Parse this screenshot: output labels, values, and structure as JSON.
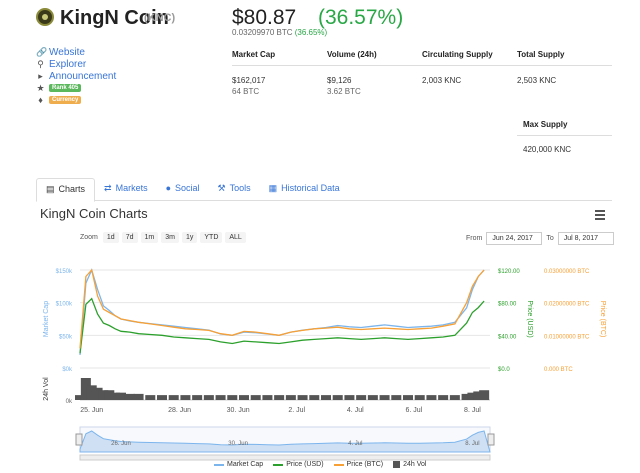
{
  "header": {
    "name": "KingN Coin",
    "symbol": "(KNC)",
    "price_usd": "$80.87",
    "change_usd": "(36.57%)",
    "price_btc": "0.03209970 BTC",
    "change_btc": "(36.65%)"
  },
  "links": {
    "website": "Website",
    "explorer": "Explorer",
    "announcement": "Announcement",
    "rank": "Rank 405",
    "category": "Currency"
  },
  "stats": {
    "headers": [
      "Market Cap",
      "Volume (24h)",
      "Circulating Supply",
      "Total Supply"
    ],
    "market_cap": "$162,017",
    "market_cap_btc": "64 BTC",
    "volume": "$9,126",
    "volume_btc": "3.62 BTC",
    "circulating": "2,003 KNC",
    "total": "2,503 KNC",
    "max_supply_label": "Max Supply",
    "max_supply": "420,000 KNC"
  },
  "tabs": [
    "Charts",
    "Markets",
    "Social",
    "Tools",
    "Historical Data"
  ],
  "charts_title": "KingN Coin Charts",
  "zoom": {
    "label": "Zoom",
    "buttons": [
      "1d",
      "7d",
      "1m",
      "3m",
      "1y",
      "YTD",
      "ALL"
    ],
    "from_label": "From",
    "from": "Jun 24, 2017",
    "to_label": "To",
    "to": "Jul 8, 2017"
  },
  "colors": {
    "market_cap": "#7cb5ec",
    "price_usd": "#2ca02c",
    "price_btc": "#f7a035",
    "volume": "#555555"
  },
  "chart_data": {
    "type": "line",
    "x_ticks": [
      "25. Jun",
      "28. Jun",
      "30. Jun",
      "2. Jul",
      "4. Jul",
      "6. Jul",
      "8. Jul"
    ],
    "navigator_ticks": [
      "26. Jun",
      "30. Jun",
      "4. Jul",
      "8. Jul"
    ],
    "left_axis": {
      "label": "Market Cap",
      "ticks": [
        "$0k",
        "$50k",
        "$100k",
        "$150k"
      ],
      "ylim": [
        0,
        150000
      ]
    },
    "usd_axis": {
      "label": "Price (USD)",
      "ticks": [
        "$0.0",
        "$40.00",
        "$80.00",
        "$120.00"
      ],
      "ylim": [
        0,
        120
      ]
    },
    "btc_axis": {
      "label": "Price (BTC)",
      "ticks": [
        "0.000 BTC",
        "0.01000000 BTC",
        "0.02000000 BTC",
        "0.03000000 BTC"
      ],
      "ylim": [
        0,
        0.03
      ]
    },
    "volume_axis": {
      "label": "24h Vol",
      "ticks": [
        "0k"
      ]
    },
    "x": [
      24.6,
      24.8,
      25.0,
      25.2,
      25.4,
      25.6,
      25.8,
      26.0,
      26.3,
      26.6,
      27.0,
      27.4,
      27.8,
      28.2,
      28.6,
      29.0,
      29.4,
      29.8,
      30.2,
      30.6,
      31.0,
      31.4,
      31.8,
      32.2,
      32.6,
      33.0,
      33.4,
      33.8,
      34.2,
      34.6,
      35.0,
      35.4,
      35.8,
      36.2,
      36.6,
      37.0,
      37.4,
      37.8,
      38.0,
      38.2,
      38.4
    ],
    "series": [
      {
        "name": "Market Cap",
        "axis": "left",
        "values": [
          20000,
          130000,
          150000,
          120000,
          95000,
          88000,
          80000,
          75000,
          72000,
          70000,
          68000,
          66000,
          64000,
          62000,
          60000,
          58000,
          52000,
          50000,
          55000,
          54000,
          52000,
          50000,
          55000,
          58000,
          60000,
          62000,
          65000,
          63000,
          62000,
          64000,
          66000,
          64000,
          62000,
          63000,
          64000,
          66000,
          70000,
          92000,
          120000,
          140000,
          150000
        ]
      },
      {
        "name": "Price (USD)",
        "axis": "usd",
        "values": [
          18,
          78,
          85,
          66,
          55,
          52,
          48,
          45,
          44,
          42,
          41,
          40,
          38,
          37,
          36,
          35,
          32,
          30,
          33,
          32,
          31,
          30,
          32,
          34,
          35,
          36,
          37,
          36,
          35,
          36,
          37,
          36,
          35,
          36,
          37,
          38,
          40,
          55,
          68,
          74,
          82
        ]
      },
      {
        "name": "Price (BTC)",
        "axis": "btc",
        "values": [
          0.006,
          0.028,
          0.03,
          0.022,
          0.018,
          0.017,
          0.016,
          0.015,
          0.0145,
          0.014,
          0.0135,
          0.013,
          0.0125,
          0.012,
          0.0118,
          0.0115,
          0.0105,
          0.01,
          0.0112,
          0.011,
          0.0105,
          0.01,
          0.011,
          0.0115,
          0.012,
          0.0122,
          0.0125,
          0.012,
          0.0118,
          0.012,
          0.0122,
          0.012,
          0.0118,
          0.012,
          0.0122,
          0.0128,
          0.0135,
          0.02,
          0.025,
          0.028,
          0.03
        ]
      },
      {
        "name": "24h Vol",
        "axis": "vol",
        "values": [
          2,
          9,
          6,
          5,
          4,
          4,
          3,
          3,
          2.5,
          2.5,
          2,
          2,
          2,
          2,
          2,
          2,
          2,
          2,
          2,
          2,
          2,
          2,
          2,
          2,
          2,
          2,
          2,
          2,
          2,
          2,
          2,
          2,
          2,
          2,
          2,
          2,
          2,
          2.5,
          3,
          3.5,
          4
        ]
      }
    ]
  }
}
